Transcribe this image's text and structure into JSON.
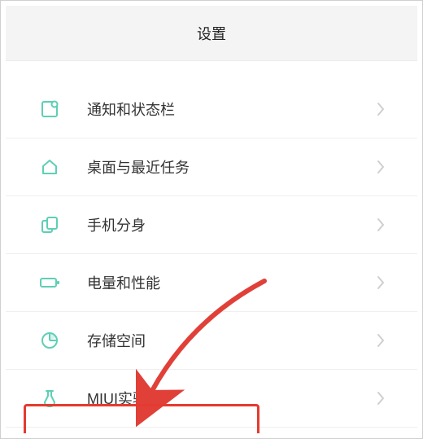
{
  "header": {
    "title": "设置"
  },
  "colors": {
    "icon": "#5ecfb5",
    "chevron": "#cfcfcf",
    "divider": "#f0efef",
    "highlight": "#e43a2f",
    "arrow": "#e04038"
  },
  "rows": [
    {
      "label": "通知和状态栏",
      "icon": "notification-bar-icon"
    },
    {
      "label": "桌面与最近任务",
      "icon": "home-icon"
    },
    {
      "label": "手机分身",
      "icon": "clone-icon"
    },
    {
      "label": "电量和性能",
      "icon": "battery-icon"
    },
    {
      "label": "存储空间",
      "icon": "storage-icon"
    },
    {
      "label": "MIUI实验室",
      "icon": "lab-icon"
    }
  ]
}
